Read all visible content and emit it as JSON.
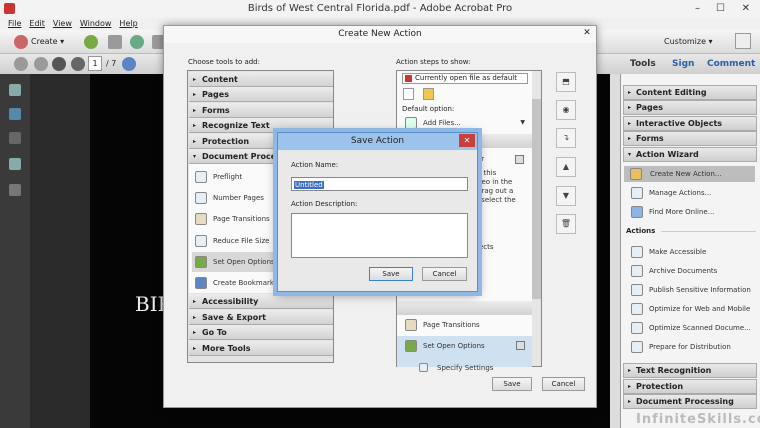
{
  "window": {
    "title": "Birds of West Central Florida.pdf - Adobe Acrobat Pro",
    "controls": [
      "–",
      "☐",
      "✕"
    ]
  },
  "menu": [
    "File",
    "Edit",
    "View",
    "Window",
    "Help"
  ],
  "toolbar": {
    "create": "Create ▾",
    "customize": "Customize ▾",
    "page_current": "1",
    "page_total": "/ 7"
  },
  "tabs": [
    "Tools",
    "Sign",
    "Comment"
  ],
  "document": {
    "visible_text": "BIR"
  },
  "right_panel": {
    "sections_top": [
      "Content Editing",
      "Pages",
      "Interactive Objects",
      "Forms",
      "Action Wizard"
    ],
    "wizard_items": [
      "Create New Action...",
      "Manage Actions...",
      "Find More Online..."
    ],
    "actions_label": "Actions",
    "actions": [
      "Make Accessible",
      "Archive Documents",
      "Publish Sensitive Information",
      "Optimize for Web and Mobile",
      "Optimize Scanned Docume...",
      "Prepare for Distribution"
    ],
    "sections_bottom": [
      "Text Recognition",
      "Protection",
      "Document Processing"
    ]
  },
  "create_dialog": {
    "title": "Create New Action",
    "tools_label": "Choose tools to add:",
    "tool_sections_top": [
      "Content",
      "Pages",
      "Forms",
      "Recognize Text",
      "Protection",
      "Document Processing"
    ],
    "tool_items": [
      "Preflight",
      "Number Pages",
      "Page Transitions",
      "Reduce File Size",
      "Set Open Options",
      "Create Bookmarks fo"
    ],
    "tool_sections_bottom": [
      "Accessibility",
      "Save & Export",
      "Go To",
      "More Tools"
    ],
    "steps_label": "Action steps to show:",
    "file_source": "Currently open file as default",
    "default_option_label": "Default option:",
    "add_files": "Add Files...",
    "partial_text": [
      "er",
      "o this",
      "deo in the",
      "drag out a",
      "l select the",
      "jects"
    ],
    "steps": [
      "Page Transitions",
      "Set Open Options",
      "Specify Settings"
    ],
    "save": "Save",
    "cancel": "Cancel"
  },
  "save_dialog": {
    "title": "Save Action",
    "name_label": "Action Name:",
    "name_value": "Untitled",
    "desc_label": "Action Description:",
    "desc_value": "",
    "save": "Save",
    "cancel": "Cancel"
  },
  "watermark": "InfiniteSkills.com"
}
